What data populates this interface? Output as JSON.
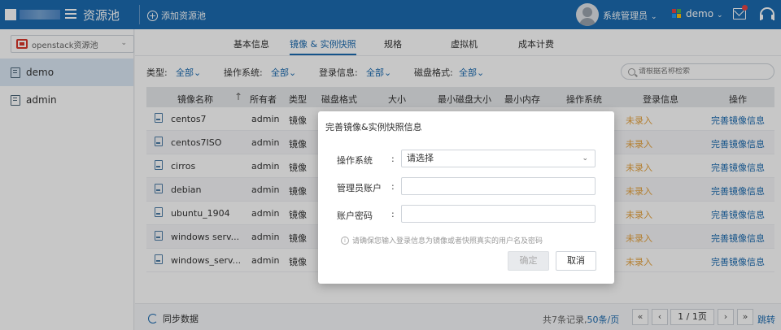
{
  "topbar": {
    "app_title": "资源池",
    "add_pool_label": "添加资源池",
    "user_name": "系统管理员",
    "project_name": "demo",
    "caret": "⌄",
    "colors": {
      "bar": "#1c6bb0",
      "project_icon": [
        "#e54545",
        "#4caf50",
        "#2196f3",
        "#ffc107"
      ]
    }
  },
  "sidebar": {
    "pool_select_value": "openstack资源池",
    "chevron": "⌄",
    "items": [
      {
        "label": "demo",
        "active": true
      },
      {
        "label": "admin",
        "active": false
      }
    ]
  },
  "tabs": [
    {
      "label": "基本信息"
    },
    {
      "label": "镜像 & 实例快照",
      "active": true
    },
    {
      "label": "规格"
    },
    {
      "label": "虚拟机"
    },
    {
      "label": "成本计费"
    }
  ],
  "filters": [
    {
      "label": "类型:",
      "value": "全部⌄"
    },
    {
      "label": "操作系统:",
      "value": "全部⌄"
    },
    {
      "label": "登录信息:",
      "value": "全部⌄"
    },
    {
      "label": "磁盘格式:",
      "value": "全部⌄"
    }
  ],
  "search": {
    "placeholder": "请根据名称检索"
  },
  "table": {
    "columns": [
      "镜像名称",
      "所有者",
      "类型",
      "磁盘格式",
      "大小",
      "最小磁盘大小",
      "最小内存",
      "操作系统",
      "登录信息",
      "操作"
    ],
    "sort_indicator": "↑",
    "rows": [
      {
        "name": "centos7",
        "owner": "admin",
        "type": "镜像",
        "login": "未录入",
        "action": "完善镜像信息"
      },
      {
        "name": "centos7ISO",
        "owner": "admin",
        "type": "镜像",
        "login": "未录入",
        "action": "完善镜像信息"
      },
      {
        "name": "cirros",
        "owner": "admin",
        "type": "镜像",
        "login": "未录入",
        "action": "完善镜像信息"
      },
      {
        "name": "debian",
        "owner": "admin",
        "type": "镜像",
        "login": "未录入",
        "action": "完善镜像信息"
      },
      {
        "name": "ubuntu_1904",
        "owner": "admin",
        "type": "镜像",
        "login": "未录入",
        "action": "完善镜像信息"
      },
      {
        "name": "windows serv...",
        "owner": "admin",
        "type": "镜像",
        "login": "未录入",
        "action": "完善镜像信息"
      },
      {
        "name": "windows_serv...",
        "owner": "admin",
        "type": "镜像",
        "login": "未录入",
        "action": "完善镜像信息"
      }
    ]
  },
  "footer": {
    "sync_label": "同步数据",
    "total_prefix": "共7条记录,",
    "page_size": "50条/页",
    "first": "«",
    "prev": "‹",
    "current_page": "1 / 1页",
    "next": "›",
    "last": "»",
    "jump_label": "跳转"
  },
  "modal": {
    "title": "完善镜像&实例快照信息",
    "fields": [
      {
        "label": "操作系统",
        "colon": ":",
        "value": "请选择",
        "dropdown": "⌄"
      },
      {
        "label": "管理员账户",
        "colon": ":",
        "value": ""
      },
      {
        "label": "账户密码",
        "colon": ":",
        "value": ""
      }
    ],
    "hint": "请确保您输入登录信息为镜像或者快照真实的用户名及密码",
    "info_glyph": "i",
    "ok_label": "确定",
    "cancel_label": "取消"
  }
}
